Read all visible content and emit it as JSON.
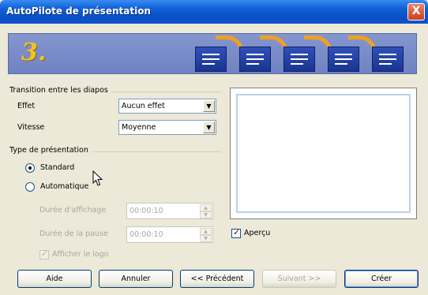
{
  "window": {
    "title": "AutoPilote de présentation",
    "close_glyph": "X"
  },
  "banner": {
    "step": "3."
  },
  "transition": {
    "group_label": "Transition entre les diapos",
    "effect_label": "Effet",
    "effect_value": "Aucun effet",
    "speed_label": "Vitesse",
    "speed_value": "Moyenne"
  },
  "presentation_type": {
    "group_label": "Type de présentation",
    "standard_label": "Standard",
    "standard_selected": true,
    "auto_label": "Automatique",
    "duration_page_label": "Durée d'affichage",
    "duration_page_value": "00:00:10",
    "duration_pause_label": "Durée de la pause",
    "duration_pause_value": "00:00:10",
    "show_logo_label": "Afficher le logo",
    "show_logo_checked": true
  },
  "preview": {
    "label": "Aperçu",
    "checked": true
  },
  "buttons": {
    "help": "Aide",
    "cancel": "Annuler",
    "previous": "<< Précédent",
    "next": "Suivant >>",
    "create": "Créer"
  },
  "colors": {
    "title_bar": "#0a4fc7",
    "banner": "#7385c4",
    "accent_arrow": "#f0a020"
  }
}
